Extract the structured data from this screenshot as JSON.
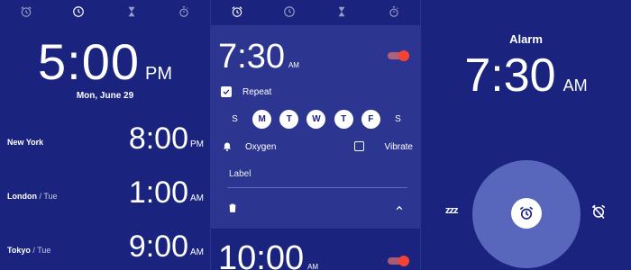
{
  "tabs": [
    {
      "name": "alarm"
    },
    {
      "name": "clock"
    },
    {
      "name": "timer"
    },
    {
      "name": "stopwatch"
    }
  ],
  "world_clock": {
    "active_tab": "clock",
    "time": "5:00",
    "ampm": "PM",
    "date": "Mon, June 29",
    "cities": [
      {
        "name": "New York",
        "day": "",
        "time": "8:00",
        "ampm": "PM"
      },
      {
        "name": "London",
        "day": "/ Tue",
        "time": "1:00",
        "ampm": "AM"
      },
      {
        "name": "Tokyo",
        "day": "/ Tue",
        "time": "9:00",
        "ampm": "AM"
      }
    ]
  },
  "alarm_editor": {
    "active_tab": "alarm",
    "time": "7:30",
    "ampm": "AM",
    "enabled": true,
    "repeat_label": "Repeat",
    "repeat_checked": true,
    "days": [
      {
        "letter": "S",
        "on": false
      },
      {
        "letter": "M",
        "on": true
      },
      {
        "letter": "T",
        "on": true
      },
      {
        "letter": "W",
        "on": true
      },
      {
        "letter": "T",
        "on": true
      },
      {
        "letter": "F",
        "on": true
      },
      {
        "letter": "S",
        "on": false
      }
    ],
    "sound": "Oxygen",
    "vibrate_label": "Vibrate",
    "vibrate_checked": false,
    "label_placeholder": "Label",
    "next_alarm_time": "10:00",
    "next_alarm_ampm": "AM"
  },
  "ringing": {
    "title": "Alarm",
    "time": "7:30",
    "ampm": "AM",
    "snooze_text": "zzz"
  },
  "colors": {
    "background": "#1a237e",
    "card": "#2c3690",
    "accent": "#f44336",
    "ring_circle": "#5c6bc0"
  }
}
